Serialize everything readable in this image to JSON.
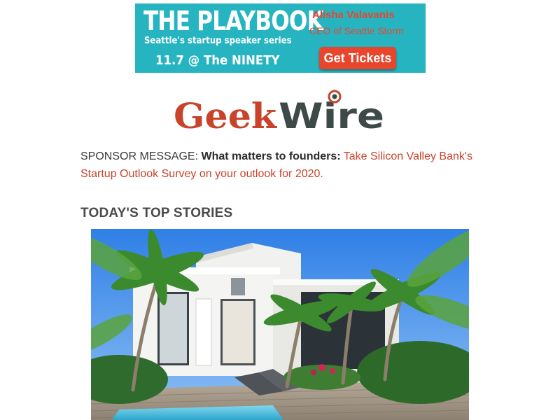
{
  "banner": {
    "title": "THE PLAYBOOK",
    "subtitle": "Seattle's startup speaker series",
    "date": "11.7 @ The NINETY",
    "speaker_name": "Alisha Valavanis",
    "speaker_role": "CEO of Seattle Storm",
    "cta_label": "Get Tickets",
    "colors": {
      "background": "#27b4c1",
      "accent": "#e8452c"
    }
  },
  "logo": {
    "part1": "Geek",
    "part2": "Wire",
    "colors": {
      "geek": "#c8432a",
      "wire": "#3d4a48",
      "signal": "#c8432a"
    }
  },
  "sponsor": {
    "prefix": "SPONSOR MESSAGE: ",
    "bold": "What matters to founders:",
    "link_text": "Take Silicon Valley Bank's Startup Outlook Survey on your outlook for 2020."
  },
  "section": {
    "heading": "TODAY'S TOP STORIES"
  },
  "story": {
    "image_icon": "photo-modern-house-with-palms-and-pool"
  }
}
